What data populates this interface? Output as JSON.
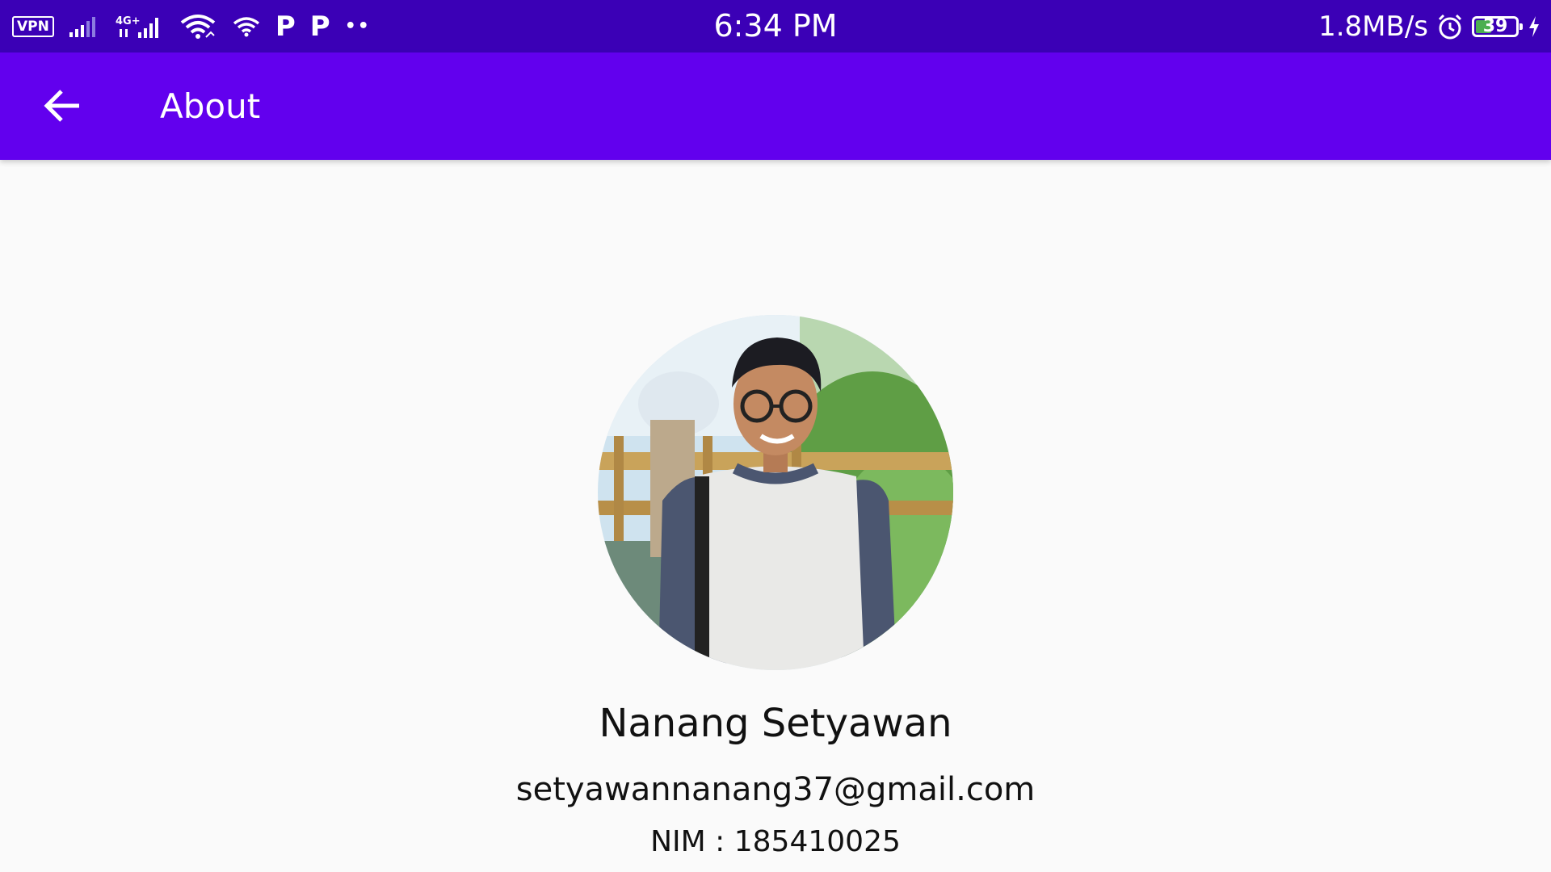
{
  "status_bar": {
    "vpn_label": "VPN",
    "network_type": "4G+",
    "p_icon_1": "P",
    "p_icon_2": "P",
    "overflow_dots": "••",
    "time": "6:34 PM",
    "net_speed": "1.8MB/s",
    "battery_level": "39",
    "battery_fraction": 0.39,
    "icons": [
      "signal-icon",
      "signal-4g-icon",
      "wifi-icon",
      "wifi-icon",
      "alarm-icon",
      "battery-icon",
      "charging-icon"
    ]
  },
  "app_bar": {
    "title": "About",
    "back_icon": "arrow-back-icon",
    "color": "#6200ee"
  },
  "profile": {
    "name": "Nanang Setyawan",
    "email": "setyawannanang37@gmail.com",
    "nim": "NIM : 185410025"
  },
  "colors": {
    "status_bar": "#3b00b6",
    "app_bar": "#6200ee",
    "background": "#fafafa",
    "text": "#111111"
  }
}
